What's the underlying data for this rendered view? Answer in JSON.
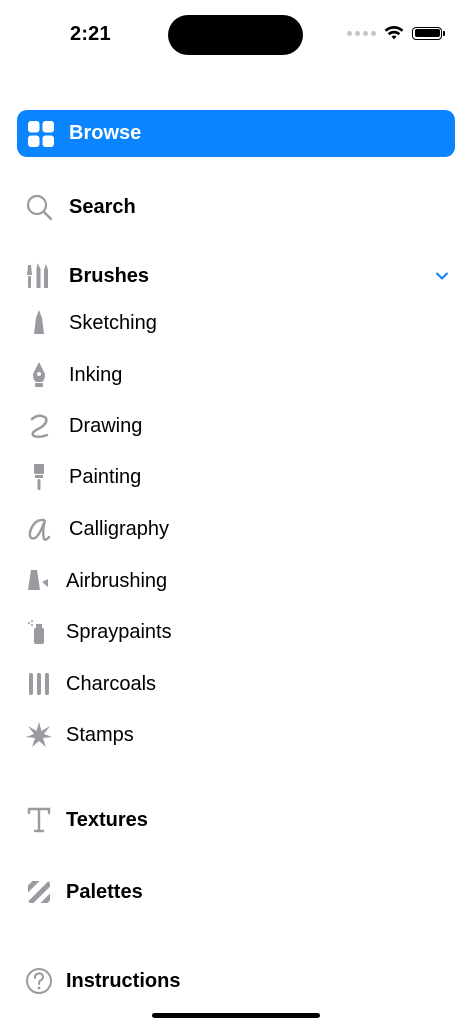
{
  "status": {
    "time": "2:21"
  },
  "menu": {
    "browse": "Browse",
    "search": "Search",
    "brushes": "Brushes",
    "brush_items": [
      "Sketching",
      "Inking",
      "Drawing",
      "Painting",
      "Calligraphy",
      "Airbrushing",
      "Spraypaints",
      "Charcoals",
      "Stamps"
    ],
    "textures": "Textures",
    "palettes": "Palettes",
    "instructions": "Instructions"
  },
  "icons": {
    "browse": "grid-icon",
    "search": "search-icon",
    "brushes": "brushes-icon",
    "textures": "text-icon",
    "palettes": "palette-stripes-icon",
    "instructions": "question-icon"
  },
  "colors": {
    "accent": "#0a84ff",
    "icon_gray": "#9a9aa0"
  }
}
